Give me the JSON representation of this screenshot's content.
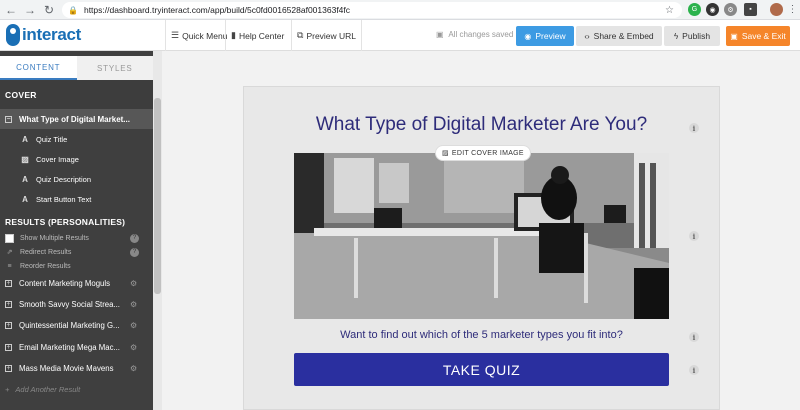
{
  "browser": {
    "url": "https://dashboard.tryinteract.com/app/build/5c0fd0016528af001363f4fc"
  },
  "app": {
    "logo_text": "interact",
    "nav": {
      "quick_menu": "Quick Menu",
      "help_center": "Help Center",
      "preview_url": "Preview URL"
    },
    "saved_status": "All changes saved",
    "buttons": {
      "preview": "Preview",
      "share_embed": "Share & Embed",
      "publish": "Publish",
      "save_exit": "Save & Exit"
    },
    "colors": {
      "brand": "#1a6fb5",
      "preview": "#3d9be3",
      "save": "#f5852a",
      "quiz_text": "#2e2c7a",
      "take_quiz": "#2a2f9f"
    }
  },
  "sidebar": {
    "tabs": [
      "CONTENT",
      "STYLES"
    ],
    "active_tab": "CONTENT",
    "cover": {
      "heading": "COVER",
      "title": "What Type of Digital Market...",
      "items": [
        {
          "label": "Quiz Title",
          "icon": "text-icon"
        },
        {
          "label": "Cover Image",
          "icon": "image-icon"
        },
        {
          "label": "Quiz Description",
          "icon": "text-icon"
        },
        {
          "label": "Start Button Text",
          "icon": "text-icon"
        }
      ]
    },
    "results": {
      "heading": "RESULTS (PERSONALITIES)",
      "options": [
        {
          "label": "Show Multiple Results",
          "checked": false
        },
        {
          "label": "Redirect Results"
        },
        {
          "label": "Reorder Results"
        }
      ],
      "items": [
        "Content Marketing Moguls",
        "Smooth Savvy Social Strea...",
        "Quintessential Marketing G...",
        "Email Marketing Mega Mac...",
        "Mass Media Movie Mavens"
      ],
      "add_label": "Add Another Result"
    }
  },
  "quiz": {
    "title": "What Type of Digital Marketer Are You?",
    "edit_cover_label": "EDIT COVER IMAGE",
    "description": "Want to find out which of the 5 marketer types you fit into?",
    "start_button": "TAKE QUIZ",
    "info_glyph": "i"
  }
}
